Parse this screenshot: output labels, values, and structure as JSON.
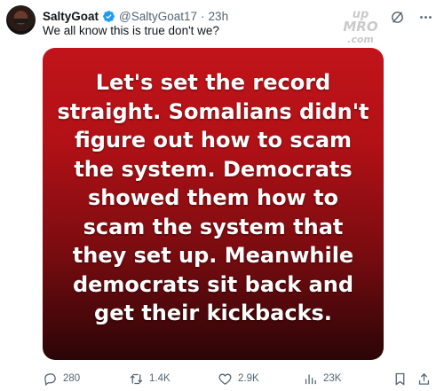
{
  "tweet": {
    "display_name": "SaltyGoat",
    "handle": "@SaltyGoat17",
    "separator": "·",
    "time": "23h",
    "text": "We all know this is true don't we?",
    "image_text": "Let's set the record\nstraight. Somalians didn't\nfigure out how to scam\nthe system. Democrats\nshowed them how to\nscam the system that\nthey set up. Meanwhile\ndemocrats sit back and\nget their kickbacks.",
    "watermark": "up\nMRO\n.com"
  },
  "stats": {
    "replies": "280",
    "reposts": "1.4K",
    "likes": "2.9K",
    "views": "23K"
  },
  "colors": {
    "verified": "#1d9bf0",
    "text_secondary": "#536471",
    "image_red": "#c0141a"
  },
  "icons": {
    "verified": "verified-badge-icon",
    "grok": "grok-icon",
    "more": "more-icon",
    "reply": "reply-icon",
    "repost": "repost-icon",
    "like": "heart-icon",
    "views": "views-icon",
    "bookmark": "bookmark-icon",
    "share": "share-icon"
  }
}
